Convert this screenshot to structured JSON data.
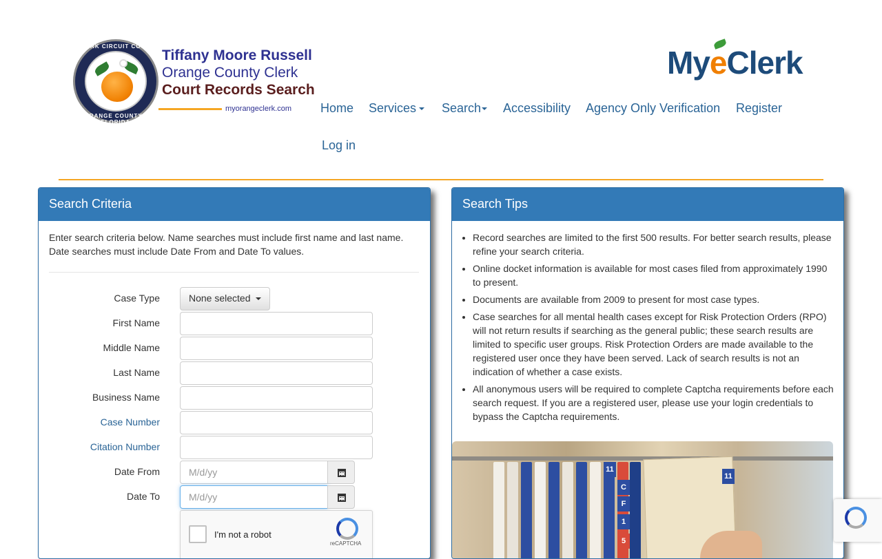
{
  "header": {
    "seal_top_text": "CLERK CIRCUIT COURT",
    "seal_bottom_text": "ORANGE COUNTY · FLORIDA",
    "brand_line1": "Tiffany Moore Russell",
    "brand_line2": "Orange County Clerk",
    "brand_line3": "Court Records Search",
    "brand_url": "myorangeclerk.com",
    "myeclerk_prefix": "My",
    "myeclerk_e": "e",
    "myeclerk_suffix": "Clerk"
  },
  "nav": {
    "items": [
      {
        "label": "Home"
      },
      {
        "label": "Services"
      },
      {
        "label": "Search"
      },
      {
        "label": "Accessibility"
      },
      {
        "label": "Agency Only Verification"
      },
      {
        "label": "Register"
      },
      {
        "label": "Log in"
      }
    ]
  },
  "search_criteria": {
    "title": "Search Criteria",
    "intro": "Enter search criteria below. Name searches must include first name and last name. Date searches must include Date From and Date To values.",
    "case_type_label": "Case Type",
    "case_type_value": "None selected",
    "first_name_label": "First Name",
    "first_name_value": "",
    "middle_name_label": "Middle Name",
    "middle_name_value": "",
    "last_name_label": "Last Name",
    "last_name_value": "",
    "business_name_label": "Business Name",
    "business_name_value": "",
    "case_number_label": "Case Number",
    "case_number_value": "",
    "citation_number_label": "Citation Number",
    "citation_number_value": "",
    "date_from_label": "Date From",
    "date_from_placeholder": "M/d/yy",
    "date_to_label": "Date To",
    "date_to_placeholder": "M/d/yy",
    "captcha_text": "I'm not a robot",
    "captcha_brand": "reCAPTCHA"
  },
  "search_tips": {
    "title": "Search Tips",
    "tips": [
      "Record searches are limited to the first 500 results. For better search results, please refine your search criteria.",
      "Online docket information is available for most cases filed from approximately 1990 to present.",
      "Documents are available from 2009 to present for most case types.",
      "Case searches for all mental health cases except for Risk Protection Orders (RPO) will not return results if searching as the general public; these search results are limited to specific user groups. Risk Protection Orders are made available to the registered user once they have been served. Lack of search results is not an indication of whether a case exists.",
      "All anonymous users will be required to complete Captcha requirements before each search request. If you are a registered user, please use your login credentials to bypass the Captcha requirements."
    ],
    "photo_tabs": [
      "11",
      "C",
      "F",
      "1",
      "5",
      "11"
    ]
  },
  "colors": {
    "panel_heading": "#337ab7",
    "link": "#2a6496",
    "accent_rule": "#f5a623"
  }
}
